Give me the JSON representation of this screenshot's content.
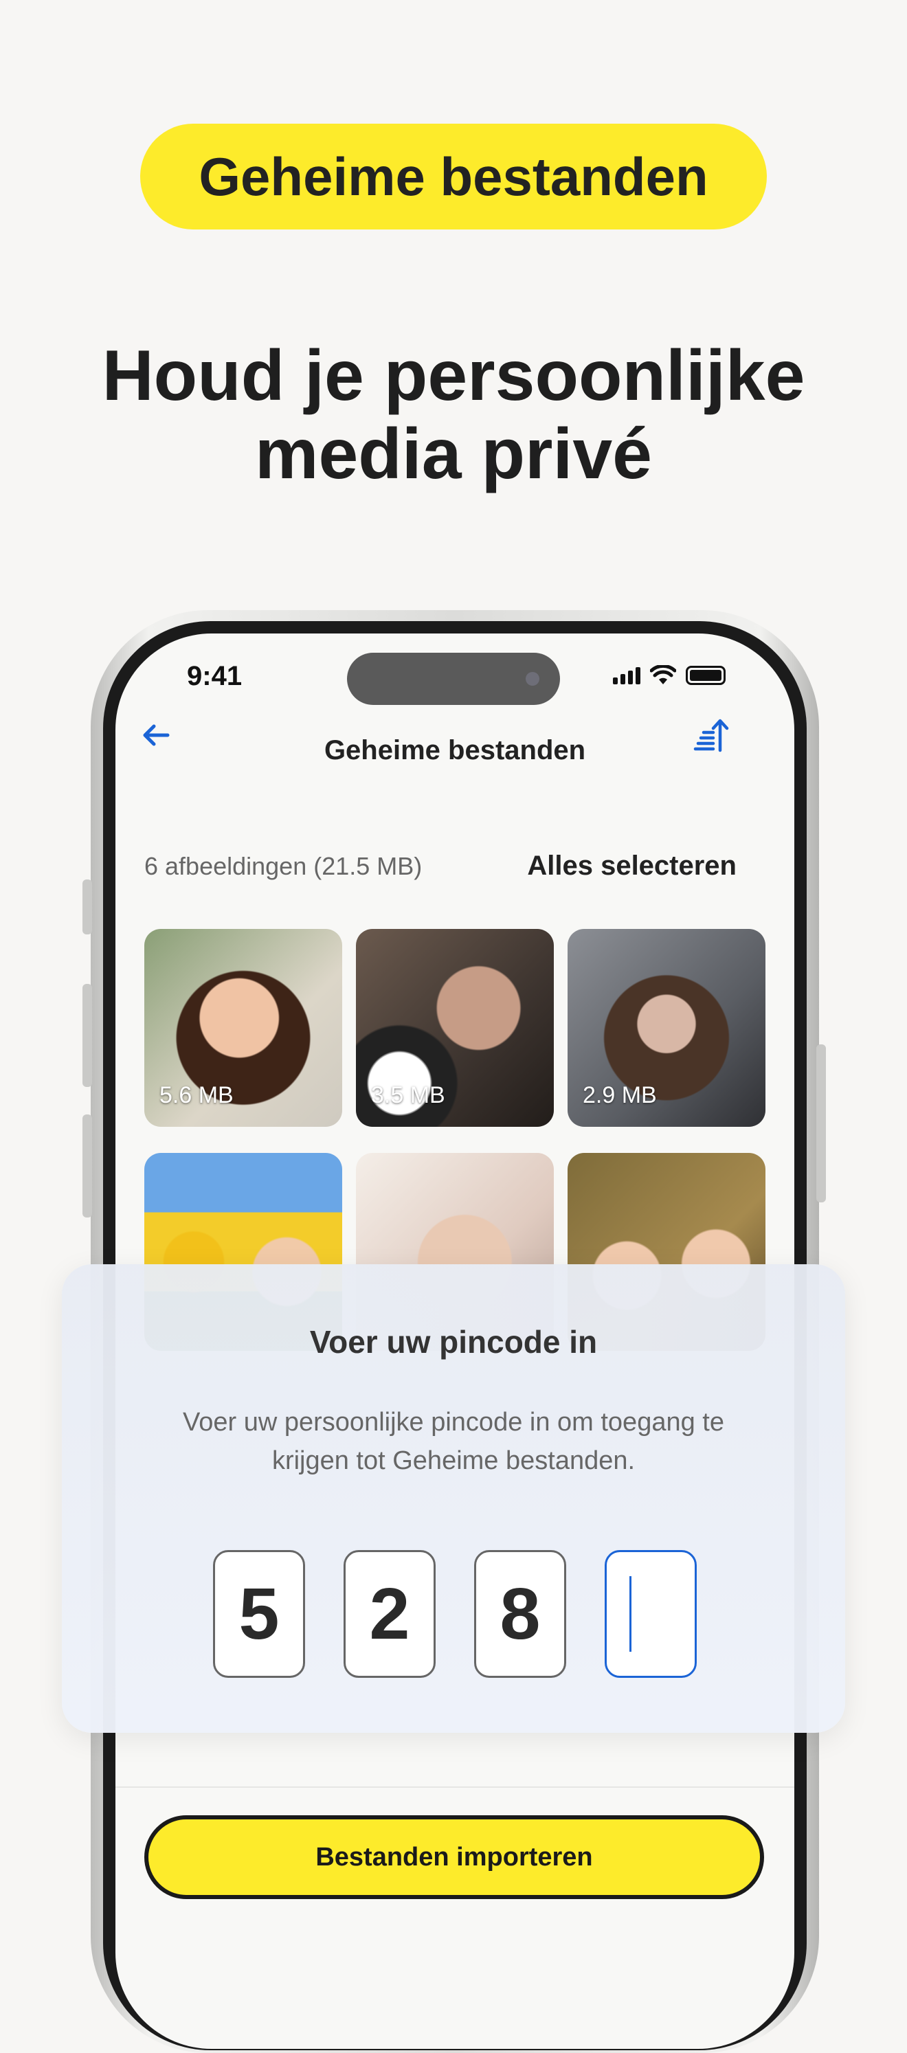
{
  "badge": "Geheime bestanden",
  "headline": {
    "line1": "Houd je persoonlijke",
    "line2": "media privé"
  },
  "status_bar": {
    "time": "9:41",
    "icons": [
      "signal-icon",
      "wifi-icon",
      "battery-icon"
    ]
  },
  "nav": {
    "title": "Geheime bestanden",
    "back_icon": "arrow-left-icon",
    "sort_icon": "sort-icon"
  },
  "gallery": {
    "count": "6 afbeeldingen (21.5 MB)",
    "select_all": "Alles selecteren",
    "items": [
      {
        "size": "5.6 MB"
      },
      {
        "size": "3.5 MB"
      },
      {
        "size": "2.9 MB"
      },
      {
        "size": ""
      },
      {
        "size": ""
      },
      {
        "size": ""
      }
    ]
  },
  "pin_sheet": {
    "title": "Voer uw pincode in",
    "text": "Voer uw persoonlijke pincode in om toegang te krijgen tot Geheime bestanden.",
    "digits": [
      "5",
      "2",
      "8",
      ""
    ]
  },
  "import_button": "Bestanden importeren",
  "colors": {
    "accent_yellow": "#fdeb2b",
    "link_blue": "#1b64d6"
  }
}
